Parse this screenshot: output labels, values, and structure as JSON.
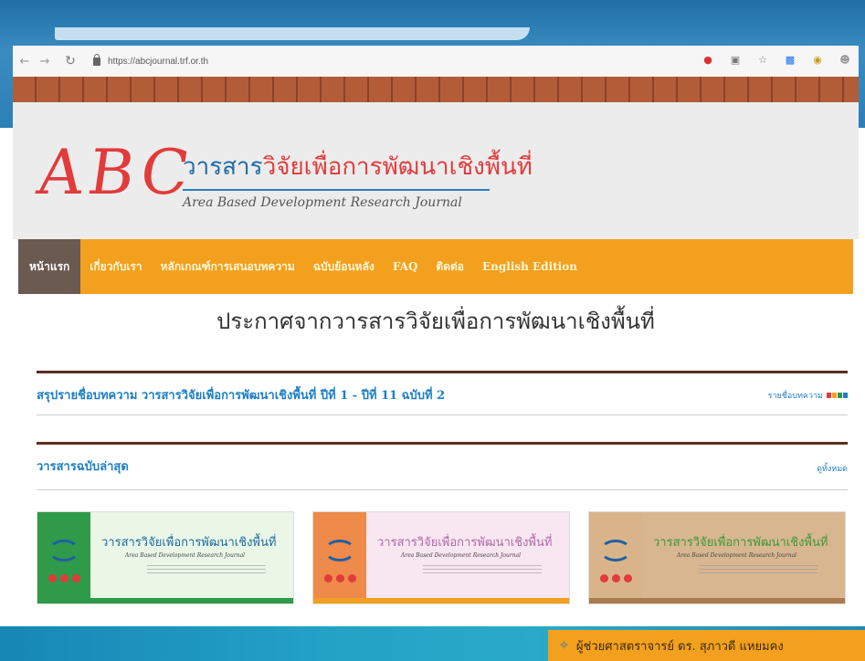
{
  "browser": {
    "url": "https://abcjournal.trf.or.th",
    "icons": [
      "camera-blocked-icon",
      "translate-icon",
      "star-icon",
      "extension-icon",
      "circle-extension-icon",
      "profile-icon"
    ]
  },
  "logo": {
    "abc": "ABC",
    "thai_part1": "วารสาร",
    "thai_part2": "วิจัยเพื่อการพัฒนาเชิงพื้นที่",
    "english": "Area Based Development Research Journal"
  },
  "menu": {
    "items": [
      {
        "label": "หน้าแรก"
      },
      {
        "label": "เกี่ยวกับเรา"
      },
      {
        "label": "หลักเกณฑ์การเสนอบทความ"
      },
      {
        "label": "ฉบับย้อนหลัง"
      },
      {
        "label": "FAQ"
      },
      {
        "label": "ติดต่อ"
      },
      {
        "label": "English Edition"
      }
    ]
  },
  "announcement": "ประกาศจากวารสารวิจัยเพื่อการพัฒนาเชิงพื้นที่",
  "summary": {
    "title": "สรุปรายชื่อบทความ วารสารวิจัยเพื่อการพัฒนาเชิงพื้นที่ ปีที่ 1 - ปีที่ 11 ฉบับที่ 2",
    "link": "รายชื่อบทความ"
  },
  "latest": {
    "title": "วารสารฉบับล่าสุด",
    "link": "ดูทั้งหมด"
  },
  "covers": [
    {
      "title": "วารสารวิจัยเพื่อการพัฒนาเชิงพื้นที่",
      "subtitle": "Area Based Development Research Journal",
      "side": "#2f9a4a",
      "bg": "#eaf6e6",
      "title_color": "#1c6aa5",
      "bar": "#2f9a4a"
    },
    {
      "title": "วารสารวิจัยเพื่อการพัฒนาเชิงพื้นที่",
      "subtitle": "Area Based Development Research Journal",
      "side": "#ee8a4a",
      "bg": "#f8e6f0",
      "title_color": "#b06aa8",
      "bar": "#f2a01e"
    },
    {
      "title": "วารสารวิจัยเพื่อการพัฒนาเชิงพื้นที่",
      "subtitle": "Area Based Development Research Journal",
      "side": "#d9b48a",
      "bg": "#d8b690",
      "title_color": "#3a9a3a",
      "bar": "#a97a4e"
    }
  ],
  "footer": {
    "name": "ผู้ช่วยศาสตราจารย์ ดร. สุภาวดี แหยมคง"
  }
}
